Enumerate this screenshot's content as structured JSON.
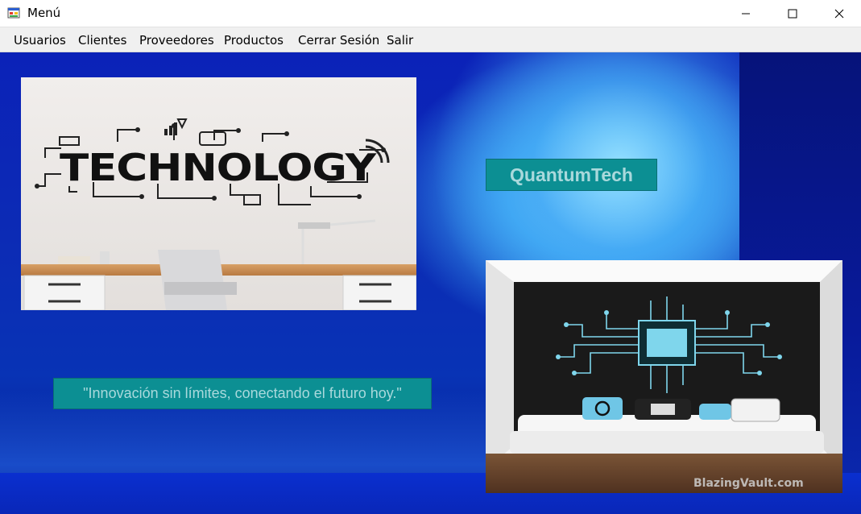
{
  "window": {
    "title": "Menú",
    "icon": "app-window-icon",
    "controls": [
      "minimize-icon",
      "maximize-icon",
      "close-icon"
    ]
  },
  "menu": {
    "items": [
      "Usuarios",
      "Clientes",
      "Proveedores",
      "Productos",
      "Cerrar Sesión",
      "Salir"
    ]
  },
  "content": {
    "brand_label": "QuantumTech",
    "slogan_label": "\"Innovación sin límites, conectando el futuro hoy.\"",
    "image1_text": "TECHNOLOGY",
    "image2_watermark": "BlazingVault.com"
  },
  "colors": {
    "label_bg": "#0c8f93",
    "label_text": "#a9d9dc",
    "background_blue": "#0b22b8"
  }
}
